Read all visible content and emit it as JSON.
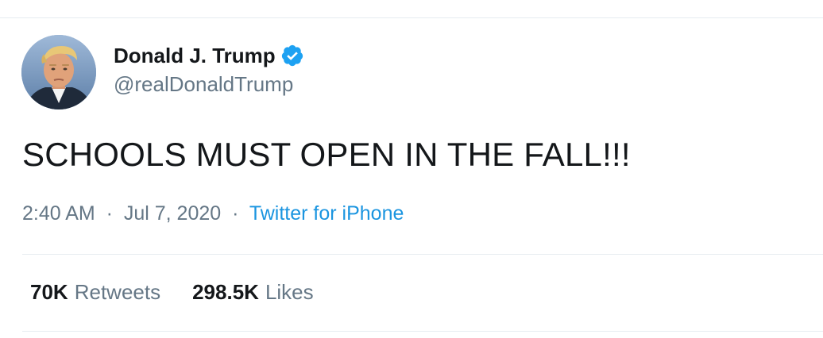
{
  "author": {
    "display_name": "Donald J. Trump",
    "handle": "@realDonaldTrump",
    "verified": true,
    "avatar_icon": "profile-photo",
    "verified_icon": "verified-badge-icon"
  },
  "tweet": {
    "text": "SCHOOLS MUST OPEN IN THE FALL!!!"
  },
  "meta": {
    "time": "2:40 AM",
    "separator": "·",
    "date": "Jul 7, 2020",
    "source": "Twitter for iPhone"
  },
  "stats": {
    "retweets_count": "70K",
    "retweets_label": "Retweets",
    "likes_count": "298.5K",
    "likes_label": "Likes"
  },
  "colors": {
    "text": "#14171a",
    "secondary_text": "#657786",
    "link": "#1b95e0",
    "verified_badge": "#1da1f2",
    "divider": "#e6ecf0"
  }
}
